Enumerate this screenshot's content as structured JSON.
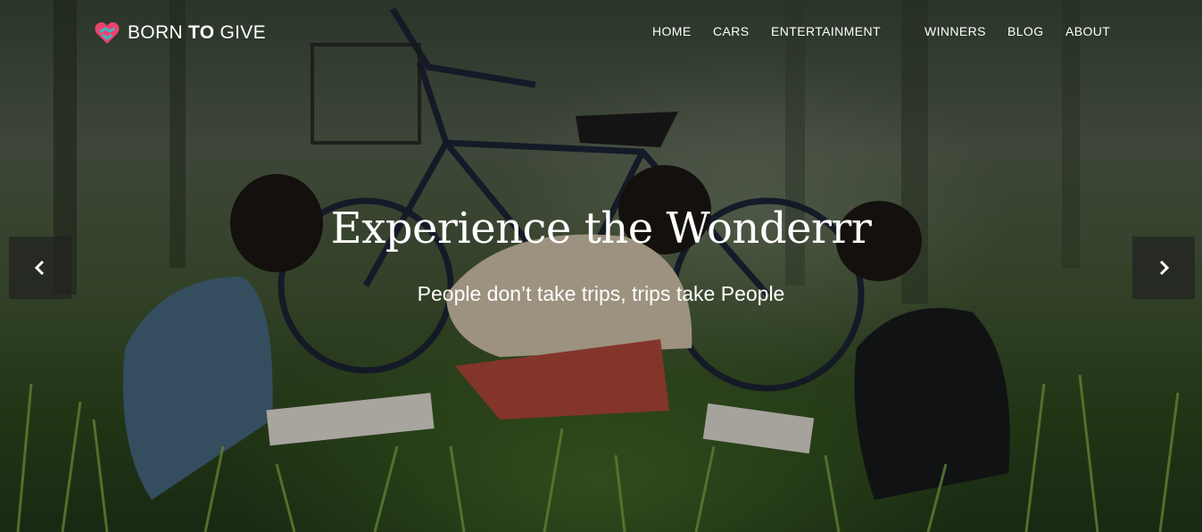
{
  "brand": {
    "name_part1": "BORN ",
    "name_part2": "TO",
    "name_part3": " GIVE",
    "icon": "heart-handshake-icon"
  },
  "nav": {
    "items": [
      {
        "label": "HOME"
      },
      {
        "label": "CARS"
      },
      {
        "label": "ENTERTAINMENT"
      },
      {
        "label": "WINNERS"
      },
      {
        "label": "BLOG"
      },
      {
        "label": "ABOUT"
      }
    ]
  },
  "hero": {
    "headline": "Experience the Wonderrr",
    "tagline": "People don’t take trips, trips take People",
    "prev_icon": "chevron-left-icon",
    "next_icon": "chevron-right-icon"
  },
  "colors": {
    "text": "#ffffff",
    "arrow_bg": "#232323",
    "logo_pink": "#e8456e",
    "logo_teal": "#3fb6c4"
  }
}
